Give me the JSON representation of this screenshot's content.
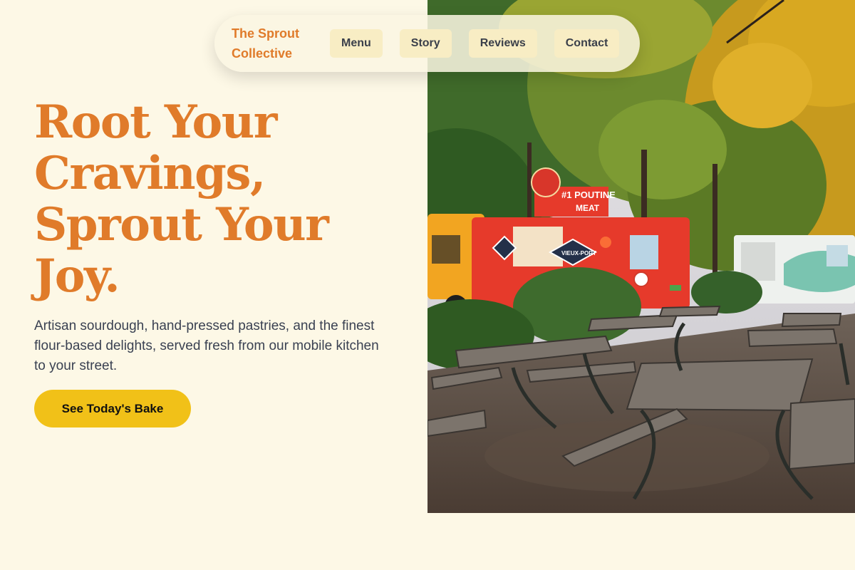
{
  "brand": {
    "name": "The Sprout\nCollective"
  },
  "nav": {
    "items": [
      {
        "label": "Menu"
      },
      {
        "label": "Story"
      },
      {
        "label": "Reviews"
      },
      {
        "label": "Contact"
      }
    ]
  },
  "hero": {
    "headline": "Root Your Cravings, Sprout Your Joy.",
    "subtext": "Artisan sourdough, hand-pressed pastries, and the finest flour-based delights, served fresh from our mobile kitchen to your street.",
    "cta_label": "See Today's Bake",
    "photo": {
      "subject": "food trucks parked beside outdoor picnic tables under autumn trees",
      "truck_sign": "#1 POUTINE",
      "truck_sign_2": "MEAT",
      "truck_logo": "VIEUX-PORT"
    }
  },
  "colors": {
    "background": "#fdf8e6",
    "brand_orange": "#e07b2a",
    "cta_yellow": "#f1c118",
    "nav_button_bg": "#f8edc4",
    "body_text": "#3a4152"
  }
}
